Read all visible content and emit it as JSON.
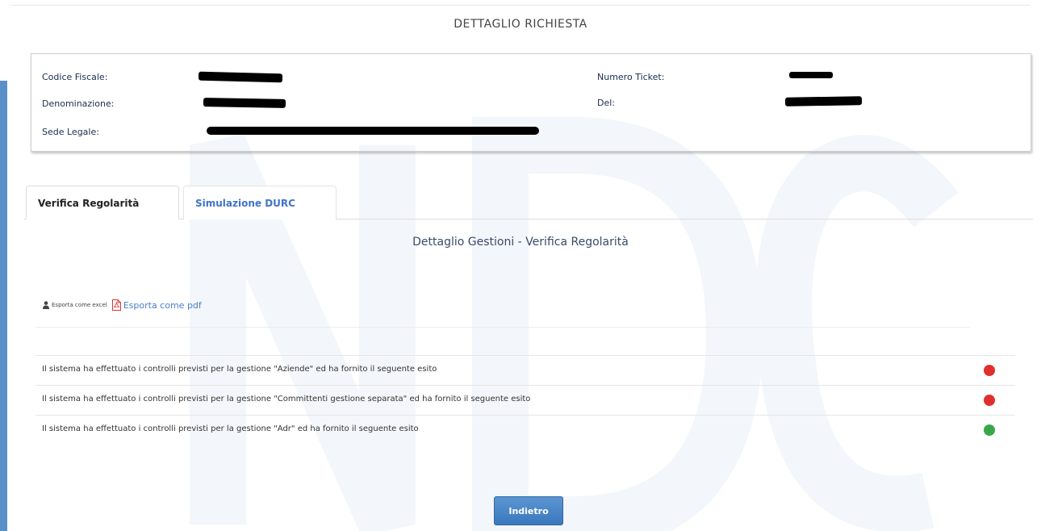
{
  "header": {
    "title": "DETTAGLIO RICHIESTA"
  },
  "info": {
    "codice_fiscale_label": "Codice Fiscale:",
    "denominazione_label": "Denominazione:",
    "sede_legale_label": "Sede Legale:",
    "numero_ticket_label": "Numero Ticket:",
    "del_label": "Del:"
  },
  "tabs": [
    {
      "label": "Verifica Regolarità",
      "active": true
    },
    {
      "label": "Simulazione DURC",
      "active": false
    }
  ],
  "section": {
    "title": "Dettaglio Gestioni - Verifica Regolarità"
  },
  "exports": {
    "excel_label": "Esporta come excel",
    "excel_icon": "user-excel-icon",
    "pdf_label": "Esporta come pdf",
    "pdf_icon": "pdf-file-icon"
  },
  "checks": [
    {
      "text": "Il sistema ha effettuato i controlli previsti per la gestione \"Aziende\" ed ha fornito il seguente esito",
      "status": "red",
      "color": "#e02f2f"
    },
    {
      "text": "Il sistema ha effettuato i controlli previsti per la gestione \"Committenti gestione separata\" ed ha fornito il seguente esito",
      "status": "red",
      "color": "#e02f2f"
    },
    {
      "text": "Il sistema ha effettuato i controlli previsti per la gestione \"Adr\" ed ha fornito il seguente esito",
      "status": "green",
      "color": "#3aa64a"
    }
  ],
  "actions": {
    "back_label": "Indietro"
  },
  "colors": {
    "accent": "#3f74c8",
    "left_bar": "#5b8fc7",
    "button": "#3a78bd"
  }
}
